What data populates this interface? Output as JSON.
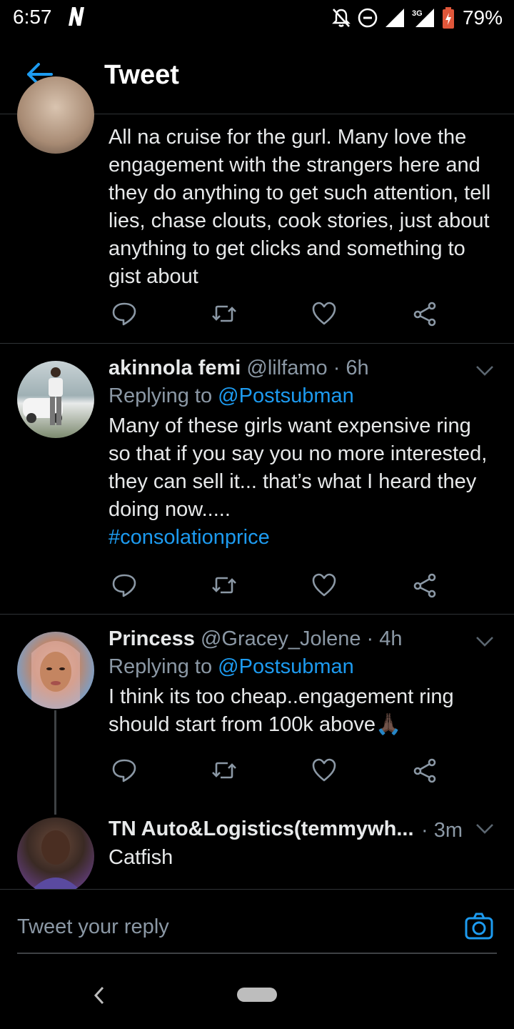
{
  "status_bar": {
    "time": "6:57",
    "battery": "79%",
    "network": "3G"
  },
  "app_bar": {
    "title": "Tweet",
    "back_icon": "arrow-left-icon"
  },
  "tweets": [
    {
      "text": "All na cruise for the gurl. Many love the engagement with the strangers here and they do anything to get such attention, tell lies, chase clouts, cook stories, just about anything to get clicks and something to gist about"
    },
    {
      "name": "akinnola femi",
      "handle": "@lilfamo",
      "time": "· 6h",
      "replying_prefix": "Replying to",
      "replying_to": "@Postsubman",
      "text": "Many of these girls want expensive ring so that if you say you no more interested, they can sell it... that’s what I heard they doing now.....",
      "hashtag": "#consolationprice"
    },
    {
      "name": "Princess",
      "handle": "@Gracey_Jolene",
      "time": "· 4h",
      "replying_prefix": "Replying to",
      "replying_to": "@Postsubman",
      "text": "I think its too cheap..engagement ring should start from 100k above🙏🏿"
    },
    {
      "name": "TN Auto&Logistics(temmywh...",
      "time": "· 3m",
      "text": "Catfish"
    }
  ],
  "reply_bar": {
    "placeholder": "Tweet your reply"
  },
  "colors": {
    "accent": "#1d9bf0",
    "background": "#000000",
    "muted": "#8b98a5"
  }
}
